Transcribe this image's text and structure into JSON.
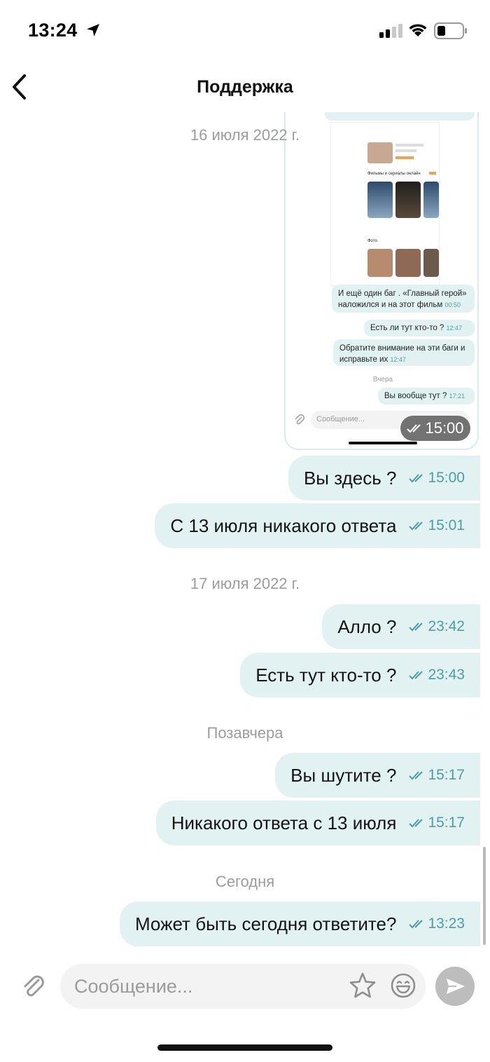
{
  "status_bar": {
    "time": "13:24"
  },
  "header": {
    "title": "Поддержка"
  },
  "separators": {
    "d1": "16 июля 2022 г.",
    "d2": "17 июля 2022 г.",
    "d3": "Позавчера",
    "d4": "Сегодня"
  },
  "screenshot": {
    "time_pill": "15:00",
    "mini": {
      "section_films": "Фильмы и сериалы онлайн",
      "section_photo": "Фото",
      "msg1": "И ещё один баг . «Главный герой» наложился и на этот фильм",
      "msg1_time": "00:50",
      "msg2": "Есть ли тут кто-то ?",
      "msg2_time": "12:47",
      "msg3": "Обратите внимание на эти баги и исправьте их",
      "msg3_time": "12:47",
      "sep": "Вчера",
      "msg4": "Вы вообще тут ?",
      "msg4_time": "17:21",
      "input_placeholder": "Сообщение..."
    }
  },
  "messages": [
    {
      "text": "Вы здесь ?",
      "time": "15:00"
    },
    {
      "text": "С 13 июля никакого ответа",
      "time": "15:01"
    },
    {
      "text": "Алло ?",
      "time": "23:42"
    },
    {
      "text": "Есть тут кто-то ?",
      "time": "23:43"
    },
    {
      "text": "Вы шутите ?",
      "time": "15:17"
    },
    {
      "text": "Никакого ответа с 13 июля",
      "time": "15:17"
    },
    {
      "text": "Может быть сегодня ответите?",
      "time": "13:23"
    }
  ],
  "composer": {
    "placeholder": "Сообщение..."
  },
  "icons": [
    "location-arrow-icon",
    "signal-icon",
    "wifi-icon",
    "battery-icon",
    "back-chevron-icon",
    "double-check-icon",
    "paperclip-icon",
    "star-icon",
    "smile-icon",
    "send-icon"
  ],
  "colors": {
    "bubble": "#e2f2f3",
    "check": "#4e9da1",
    "separator_text": "#9c9c9c"
  }
}
